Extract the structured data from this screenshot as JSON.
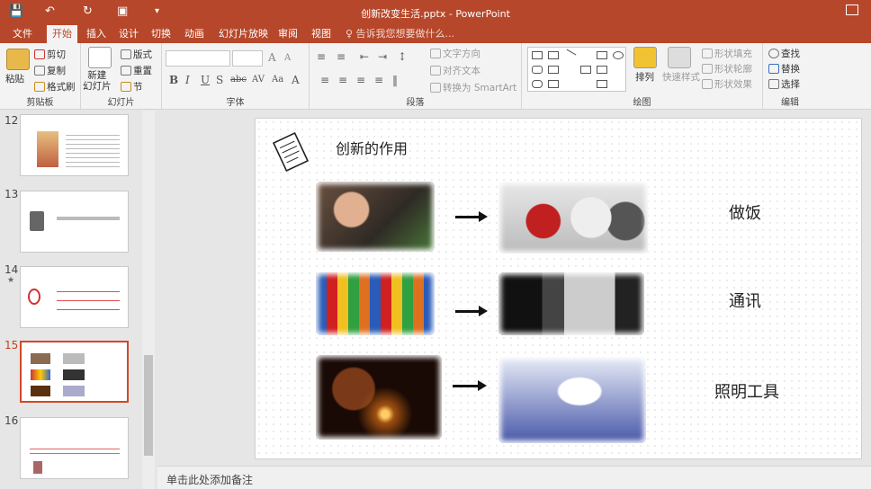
{
  "window": {
    "title": "创新改变生活.pptx - PowerPoint"
  },
  "quick_access": {
    "icons": [
      "save-icon",
      "undo-icon",
      "redo-icon",
      "start-slideshow-icon",
      "customize-toolbar-icon"
    ],
    "customize_label": "▾"
  },
  "tabs": [
    {
      "label": "文件",
      "active": false
    },
    {
      "label": "开始",
      "active": true
    },
    {
      "label": "插入",
      "active": false
    },
    {
      "label": "设计",
      "active": false
    },
    {
      "label": "切换",
      "active": false
    },
    {
      "label": "动画",
      "active": false
    },
    {
      "label": "幻灯片放映",
      "active": false
    },
    {
      "label": "审阅",
      "active": false
    },
    {
      "label": "视图",
      "active": false
    }
  ],
  "tell_me": "♀ 告诉我您想要做什么...",
  "ribbon": {
    "clipboard": {
      "paste": "粘贴",
      "cut": "剪切",
      "copy": "复制",
      "format_painter": "格式刷",
      "group": "剪贴板"
    },
    "slides": {
      "new_slide": "新建\n幻灯片",
      "layout": "版式",
      "reset": "重置",
      "section": "节",
      "group": "幻灯片"
    },
    "font": {
      "group": "字体",
      "buttons": [
        "B",
        "I",
        "U",
        "S",
        "abc",
        "AV",
        "Aa",
        "A"
      ]
    },
    "paragraph": {
      "text_direction": "文字方向",
      "align_text": "对齐文本",
      "smartart": "转换为 SmartArt",
      "group": "段落"
    },
    "drawing": {
      "arrange": "排列",
      "quick_styles": "快速样式",
      "shape_fill": "形状填充",
      "shape_outline": "形状轮廓",
      "shape_effects": "形状效果",
      "group": "绘图"
    },
    "editing": {
      "find": "查找",
      "replace": "替换",
      "select": "选择",
      "group": "编辑"
    }
  },
  "slides_panel": [
    {
      "number": "12",
      "selected": false,
      "starred": false
    },
    {
      "number": "13",
      "selected": false,
      "starred": false
    },
    {
      "number": "14",
      "selected": false,
      "starred": true
    },
    {
      "number": "15",
      "selected": true,
      "starred": false
    },
    {
      "number": "16",
      "selected": false,
      "starred": false
    }
  ],
  "slide": {
    "title": "创新的作用",
    "rows": [
      {
        "label": "做饭"
      },
      {
        "label": "通讯"
      },
      {
        "label": "照明工具"
      }
    ]
  },
  "notes_placeholder": "单击此处添加备注",
  "colors": {
    "accent": "#b7472a",
    "selection": "#d24726"
  }
}
